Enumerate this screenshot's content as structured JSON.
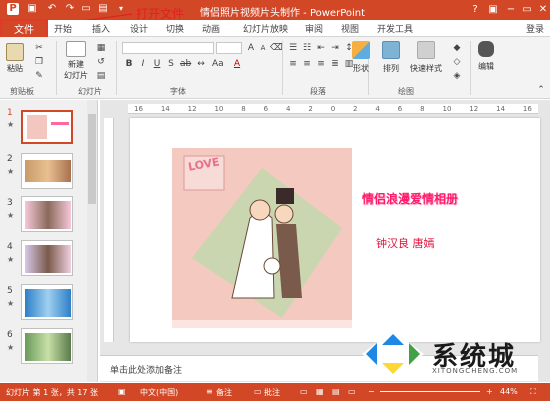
{
  "titlebar": {
    "title": "情侣照片视频片头制作 - PowerPoint",
    "help": "?",
    "minimize": "−",
    "restore": "▭",
    "close": "✕"
  },
  "annotation": {
    "text": "打开文件"
  },
  "tabs": {
    "file": "文件",
    "home": "开始",
    "insert": "插入",
    "design": "设计",
    "transitions": "切换",
    "animations": "动画",
    "slideshow": "幻灯片放映",
    "review": "审阅",
    "view": "视图",
    "developer": "开发工具",
    "login": "登录"
  },
  "ribbon": {
    "paste": "粘贴",
    "new_slide": "新建\n幻灯片",
    "new_slide_l1": "新建",
    "new_slide_l2": "幻灯片",
    "shapes": "形状",
    "arrange": "排列",
    "quick_styles": "快速样式",
    "editing": "编辑",
    "groups": {
      "clipboard": "剪贴板",
      "slides": "幻灯片",
      "font": "字体",
      "paragraph": "段落",
      "drawing": "绘图"
    }
  },
  "ruler": {
    "ticks": [
      "16",
      "14",
      "12",
      "10",
      "8",
      "6",
      "4",
      "2",
      "0",
      "2",
      "4",
      "6",
      "8",
      "10",
      "12",
      "14",
      "16"
    ]
  },
  "slides": [
    {
      "num": "1",
      "star": "★"
    },
    {
      "num": "2",
      "star": "★"
    },
    {
      "num": "3",
      "star": "★"
    },
    {
      "num": "4",
      "star": "★"
    },
    {
      "num": "5",
      "star": "★"
    },
    {
      "num": "6",
      "star": "★"
    }
  ],
  "slide_content": {
    "title": "情侣浪漫爱情相册",
    "author": "钟汉良 唐嫣",
    "love": "LOVE"
  },
  "notes": {
    "placeholder": "单击此处添加备注"
  },
  "status": {
    "slide_info": "幻灯片 第 1 张，共 17 张",
    "language": "中文(中国)",
    "notes": "备注",
    "comments": "批注",
    "zoom": "44%"
  },
  "watermark": {
    "text": "系统城",
    "url": "XITONGCHENG.COM"
  },
  "colors": {
    "accent": "#d24726",
    "title_pink": "#ff1a6c"
  }
}
